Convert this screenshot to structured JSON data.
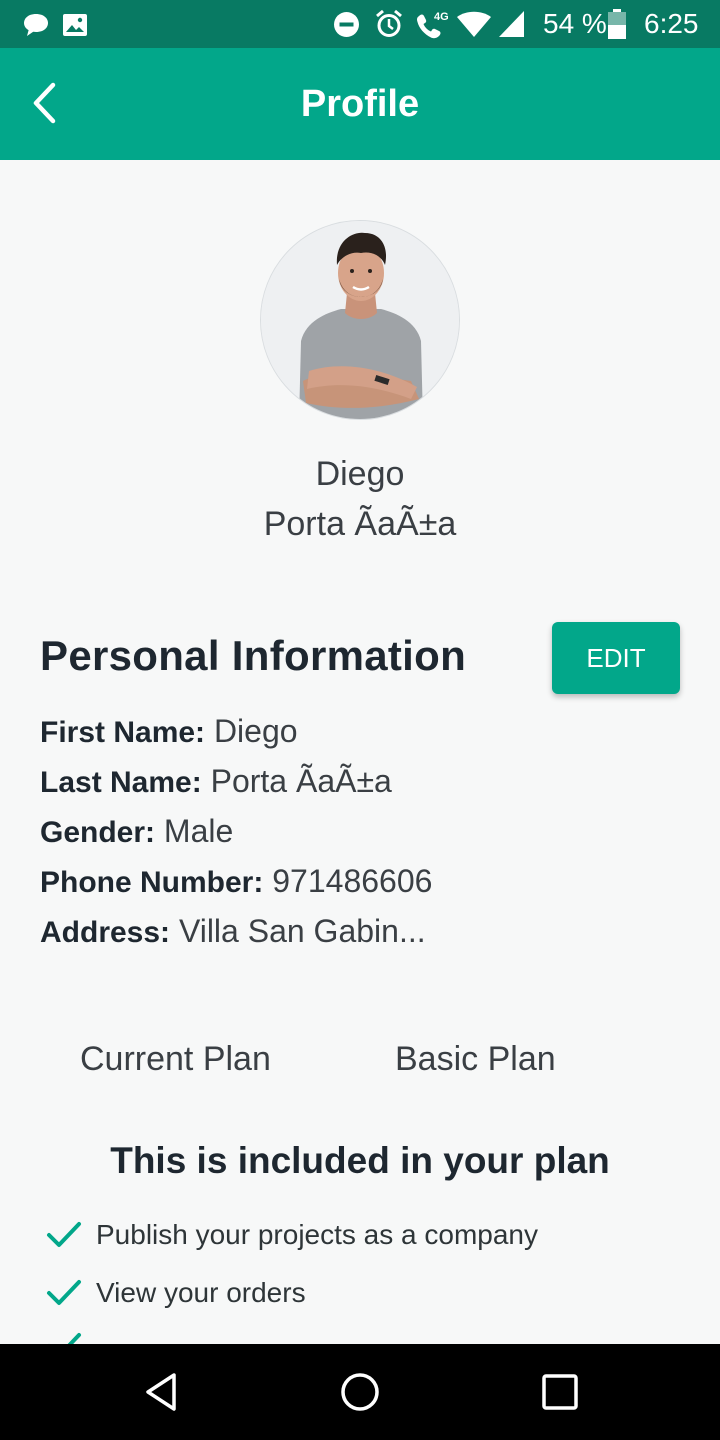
{
  "status_bar": {
    "battery_percent": "54 %",
    "time": "6:25",
    "icons": [
      "chat-bubble-icon",
      "image-icon",
      "do-not-disturb-icon",
      "alarm-icon",
      "wifi-call-icon",
      "wifi-icon",
      "cell-signal-icon",
      "battery-icon"
    ],
    "network_label": "4G"
  },
  "app_bar": {
    "title": "Profile",
    "back_icon": "chevron-left-icon",
    "color": "#02a78a"
  },
  "profile": {
    "first_name": "Diego",
    "last_name": "Porta ÃaÃ±a"
  },
  "personal_info": {
    "title": "Personal Information",
    "edit_label": "EDIT",
    "fields": [
      {
        "label": "First Name:",
        "value": "Diego"
      },
      {
        "label": "Last Name:",
        "value": "Porta ÃaÃ±a"
      },
      {
        "label": "Gender:",
        "value": "Male"
      },
      {
        "label": "Phone Number:",
        "value": "971486606"
      },
      {
        "label": "Address:",
        "value": "Villa San Gabin..."
      }
    ]
  },
  "plan": {
    "label": "Current Plan",
    "value": "Basic Plan"
  },
  "included": {
    "title": "This is included in your plan",
    "features": [
      "Publish your projects as a company",
      "View your orders"
    ],
    "check_color": "#02a78a"
  },
  "nav_bar": {
    "buttons": [
      "back-triangle-icon",
      "home-circle-icon",
      "recents-square-icon"
    ]
  }
}
